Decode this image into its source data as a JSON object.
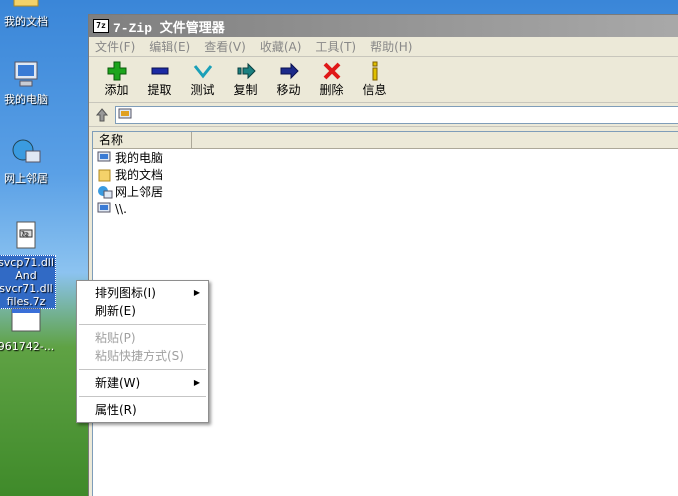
{
  "desktop": {
    "icons": [
      {
        "label": "我的文档"
      },
      {
        "label": "我的电脑"
      },
      {
        "label": "网上邻居"
      },
      {
        "label": "svcp71.dll\nAnd\nsvcr71.dll\nfiles.7z"
      },
      {
        "label": "961742-..."
      }
    ]
  },
  "window": {
    "app_icon": "7z",
    "title": "7-Zip 文件管理器",
    "menu": [
      "文件(F)",
      "编辑(E)",
      "查看(V)",
      "收藏(A)",
      "工具(T)",
      "帮助(H)"
    ],
    "toolbar": [
      {
        "label": "添加",
        "icon": "add-icon",
        "color": "#1ca51c"
      },
      {
        "label": "提取",
        "icon": "extract-icon",
        "color": "#1c2aa5"
      },
      {
        "label": "测试",
        "icon": "test-icon",
        "color": "#1aa0b8"
      },
      {
        "label": "复制",
        "icon": "copy-icon",
        "color": "#1a8080"
      },
      {
        "label": "移动",
        "icon": "move-icon",
        "color": "#1c2a8a"
      },
      {
        "label": "删除",
        "icon": "delete-icon",
        "color": "#e01818"
      },
      {
        "label": "信息",
        "icon": "info-icon",
        "color": "#e0c000"
      }
    ],
    "address": "",
    "columns": [
      "名称"
    ],
    "rows": [
      {
        "name": "我的电脑",
        "icon": "computer-icon"
      },
      {
        "name": "我的文档",
        "icon": "documents-icon"
      },
      {
        "name": "网上邻居",
        "icon": "network-icon"
      },
      {
        "name": "\\\\.",
        "icon": "computer-icon"
      }
    ]
  },
  "context_menu": {
    "items": [
      {
        "label": "排列图标(I)",
        "submenu": true,
        "enabled": true
      },
      {
        "label": "刷新(E)",
        "submenu": false,
        "enabled": true
      },
      {
        "label": "粘贴(P)",
        "submenu": false,
        "enabled": false
      },
      {
        "label": "粘贴快捷方式(S)",
        "submenu": false,
        "enabled": false
      },
      {
        "label": "新建(W)",
        "submenu": true,
        "enabled": true
      },
      {
        "label": "属性(R)",
        "submenu": false,
        "enabled": true
      }
    ]
  }
}
